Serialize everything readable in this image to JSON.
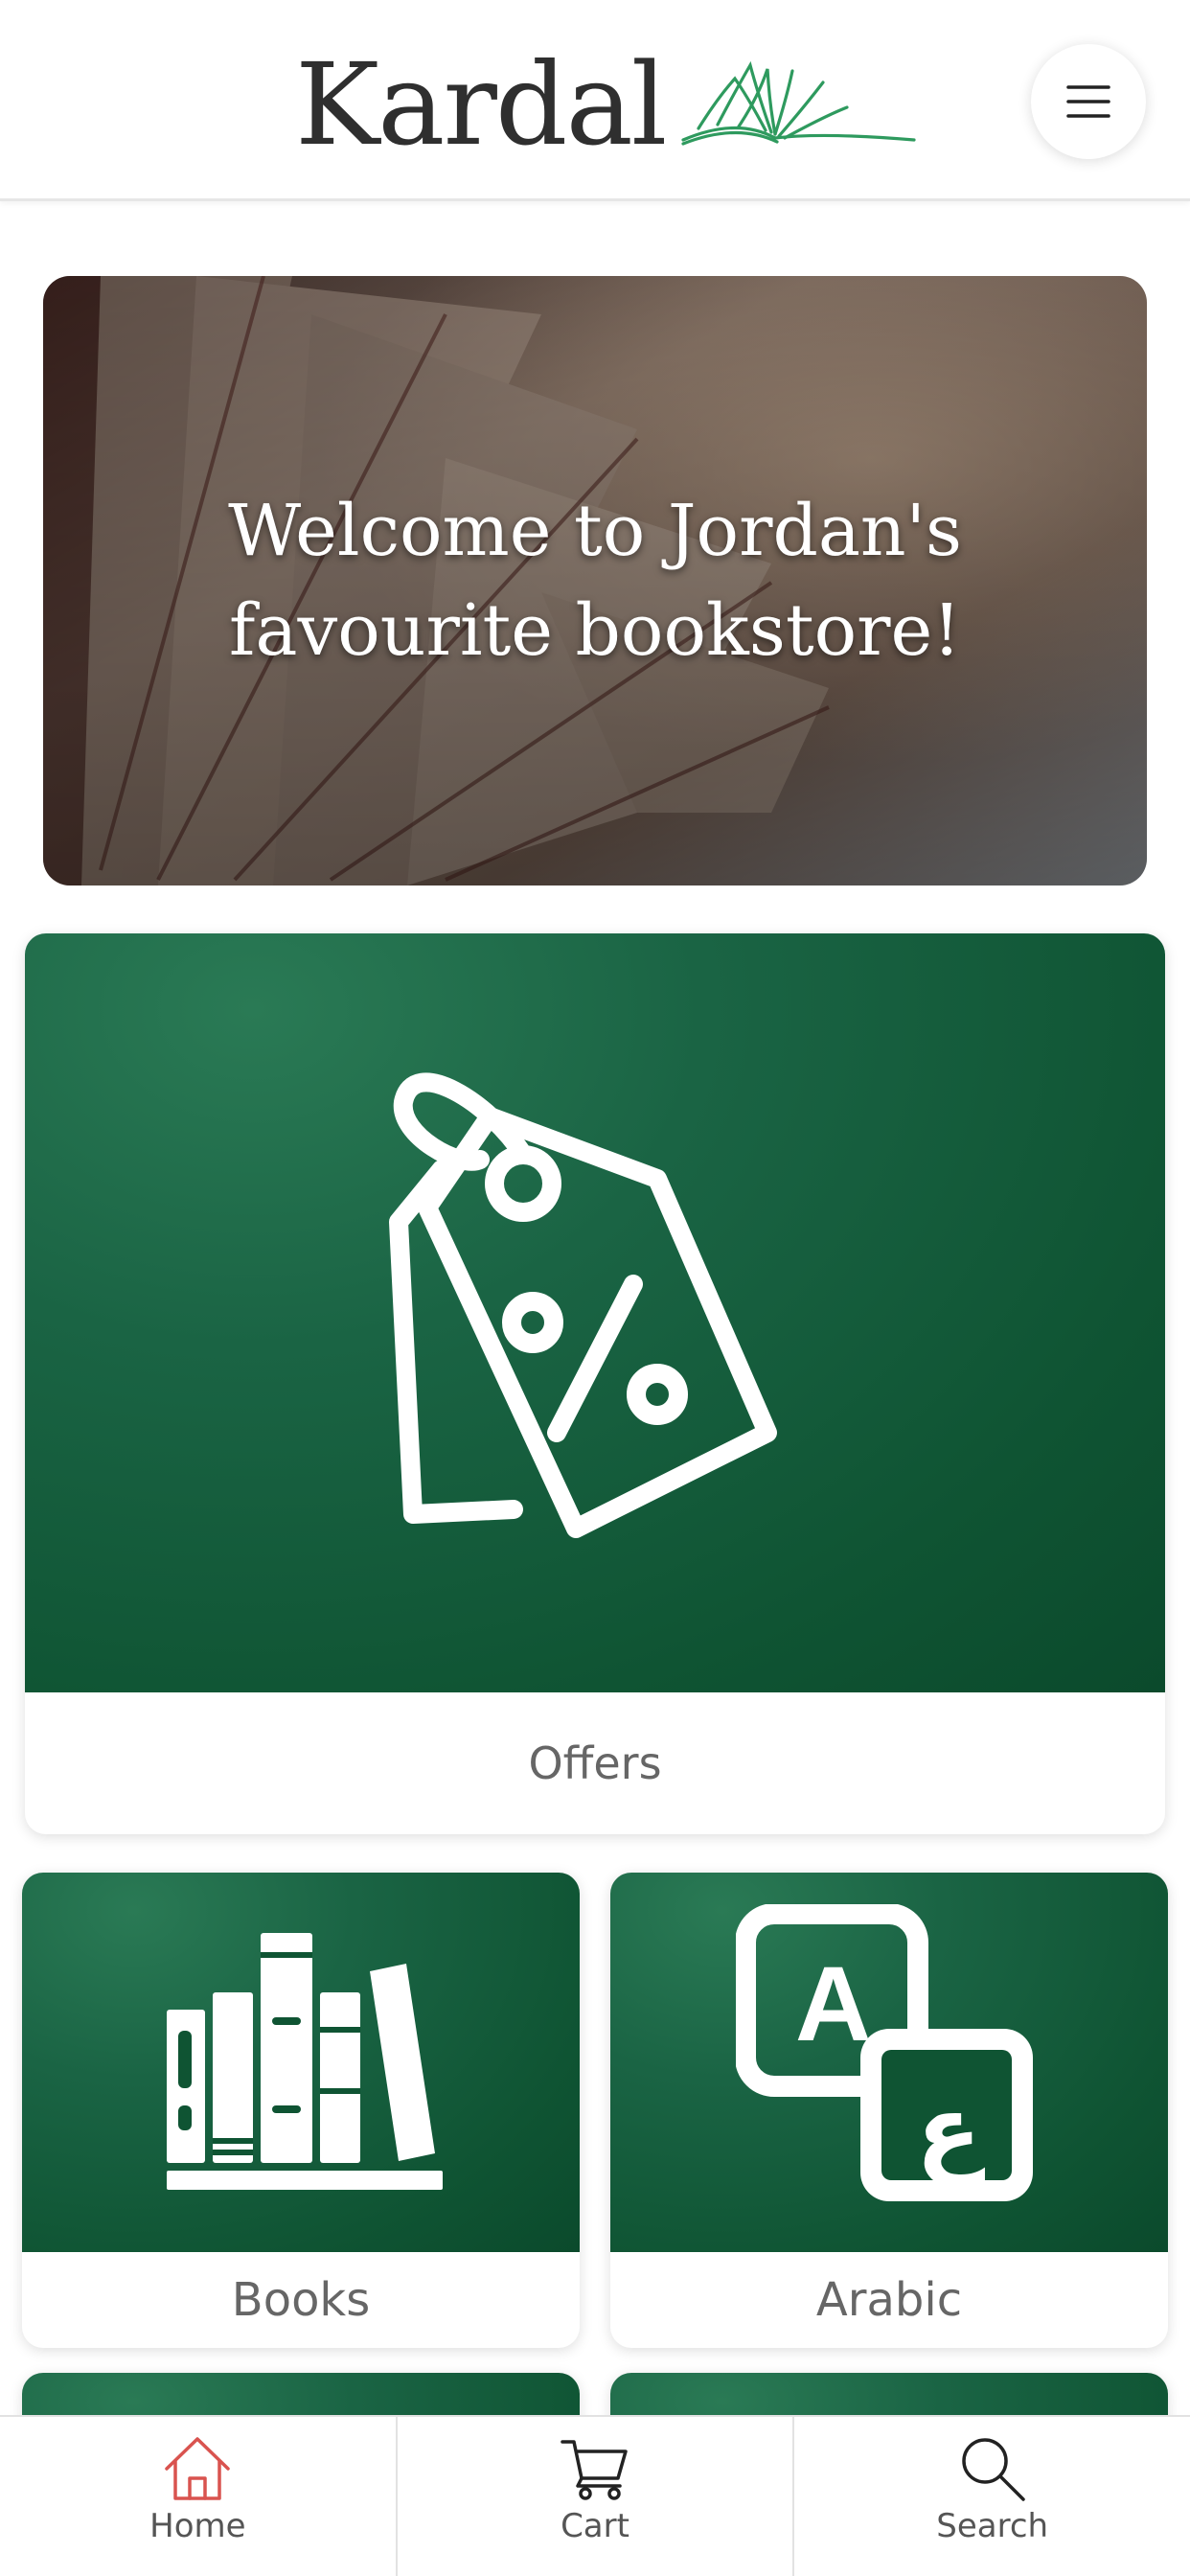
{
  "header": {
    "logo_text": "Kardal",
    "menu_icon": "hamburger-menu-icon"
  },
  "hero": {
    "title": "Welcome to Jordan's favourite bookstore!"
  },
  "categories": [
    {
      "label": "Offers",
      "icon": "price-tag-percent-icon"
    },
    {
      "label": "Books",
      "icon": "bookshelf-icon"
    },
    {
      "label": "Arabic",
      "icon": "language-translate-icon"
    }
  ],
  "bottom_nav": [
    {
      "label": "Home",
      "icon": "home-icon",
      "active": true
    },
    {
      "label": "Cart",
      "icon": "cart-icon"
    },
    {
      "label": "Search",
      "icon": "search-icon"
    }
  ],
  "colors": {
    "brand_green": "#0f5433",
    "active_nav": "#d9534f",
    "text_gray": "#666666"
  }
}
